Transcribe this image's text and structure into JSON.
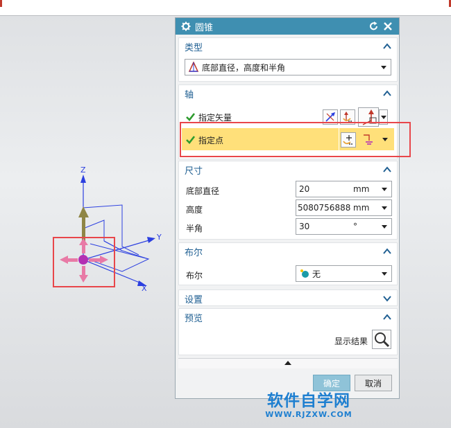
{
  "dialog": {
    "title": "圆锥"
  },
  "type_section": {
    "header": "类型",
    "selected": "底部直径，高度和半角"
  },
  "axis_section": {
    "header": "轴",
    "vector_label": "指定矢量",
    "point_label": "指定点"
  },
  "size_section": {
    "header": "尺寸",
    "fields": [
      {
        "label": "底部直径",
        "value": "20",
        "unit": "mm"
      },
      {
        "label": "高度",
        "value": "5080756888",
        "unit": "mm"
      },
      {
        "label": "半角",
        "value": "30",
        "unit": "°"
      }
    ]
  },
  "boolean_section": {
    "header": "布尔",
    "label": "布尔",
    "value": "无"
  },
  "settings_section": {
    "header": "设置"
  },
  "preview_section": {
    "header": "预览",
    "show_result": "显示结果"
  },
  "footer": {
    "ok": "确定",
    "cancel": "取消"
  },
  "viewport": {
    "axis_z": "Z",
    "axis_y": "Y",
    "axis_x": "X"
  },
  "watermark": {
    "line1": "软件自学网",
    "line2": "WWW.RJZXW.COM"
  },
  "colors": {
    "titlebar": "#3f8fb1",
    "section_header": "#1f5f92",
    "highlight_row": "#ffe07a",
    "annotation_red": "#e8464a",
    "ok_button": "#8fc3d8",
    "watermark": "#1e7fd0"
  }
}
